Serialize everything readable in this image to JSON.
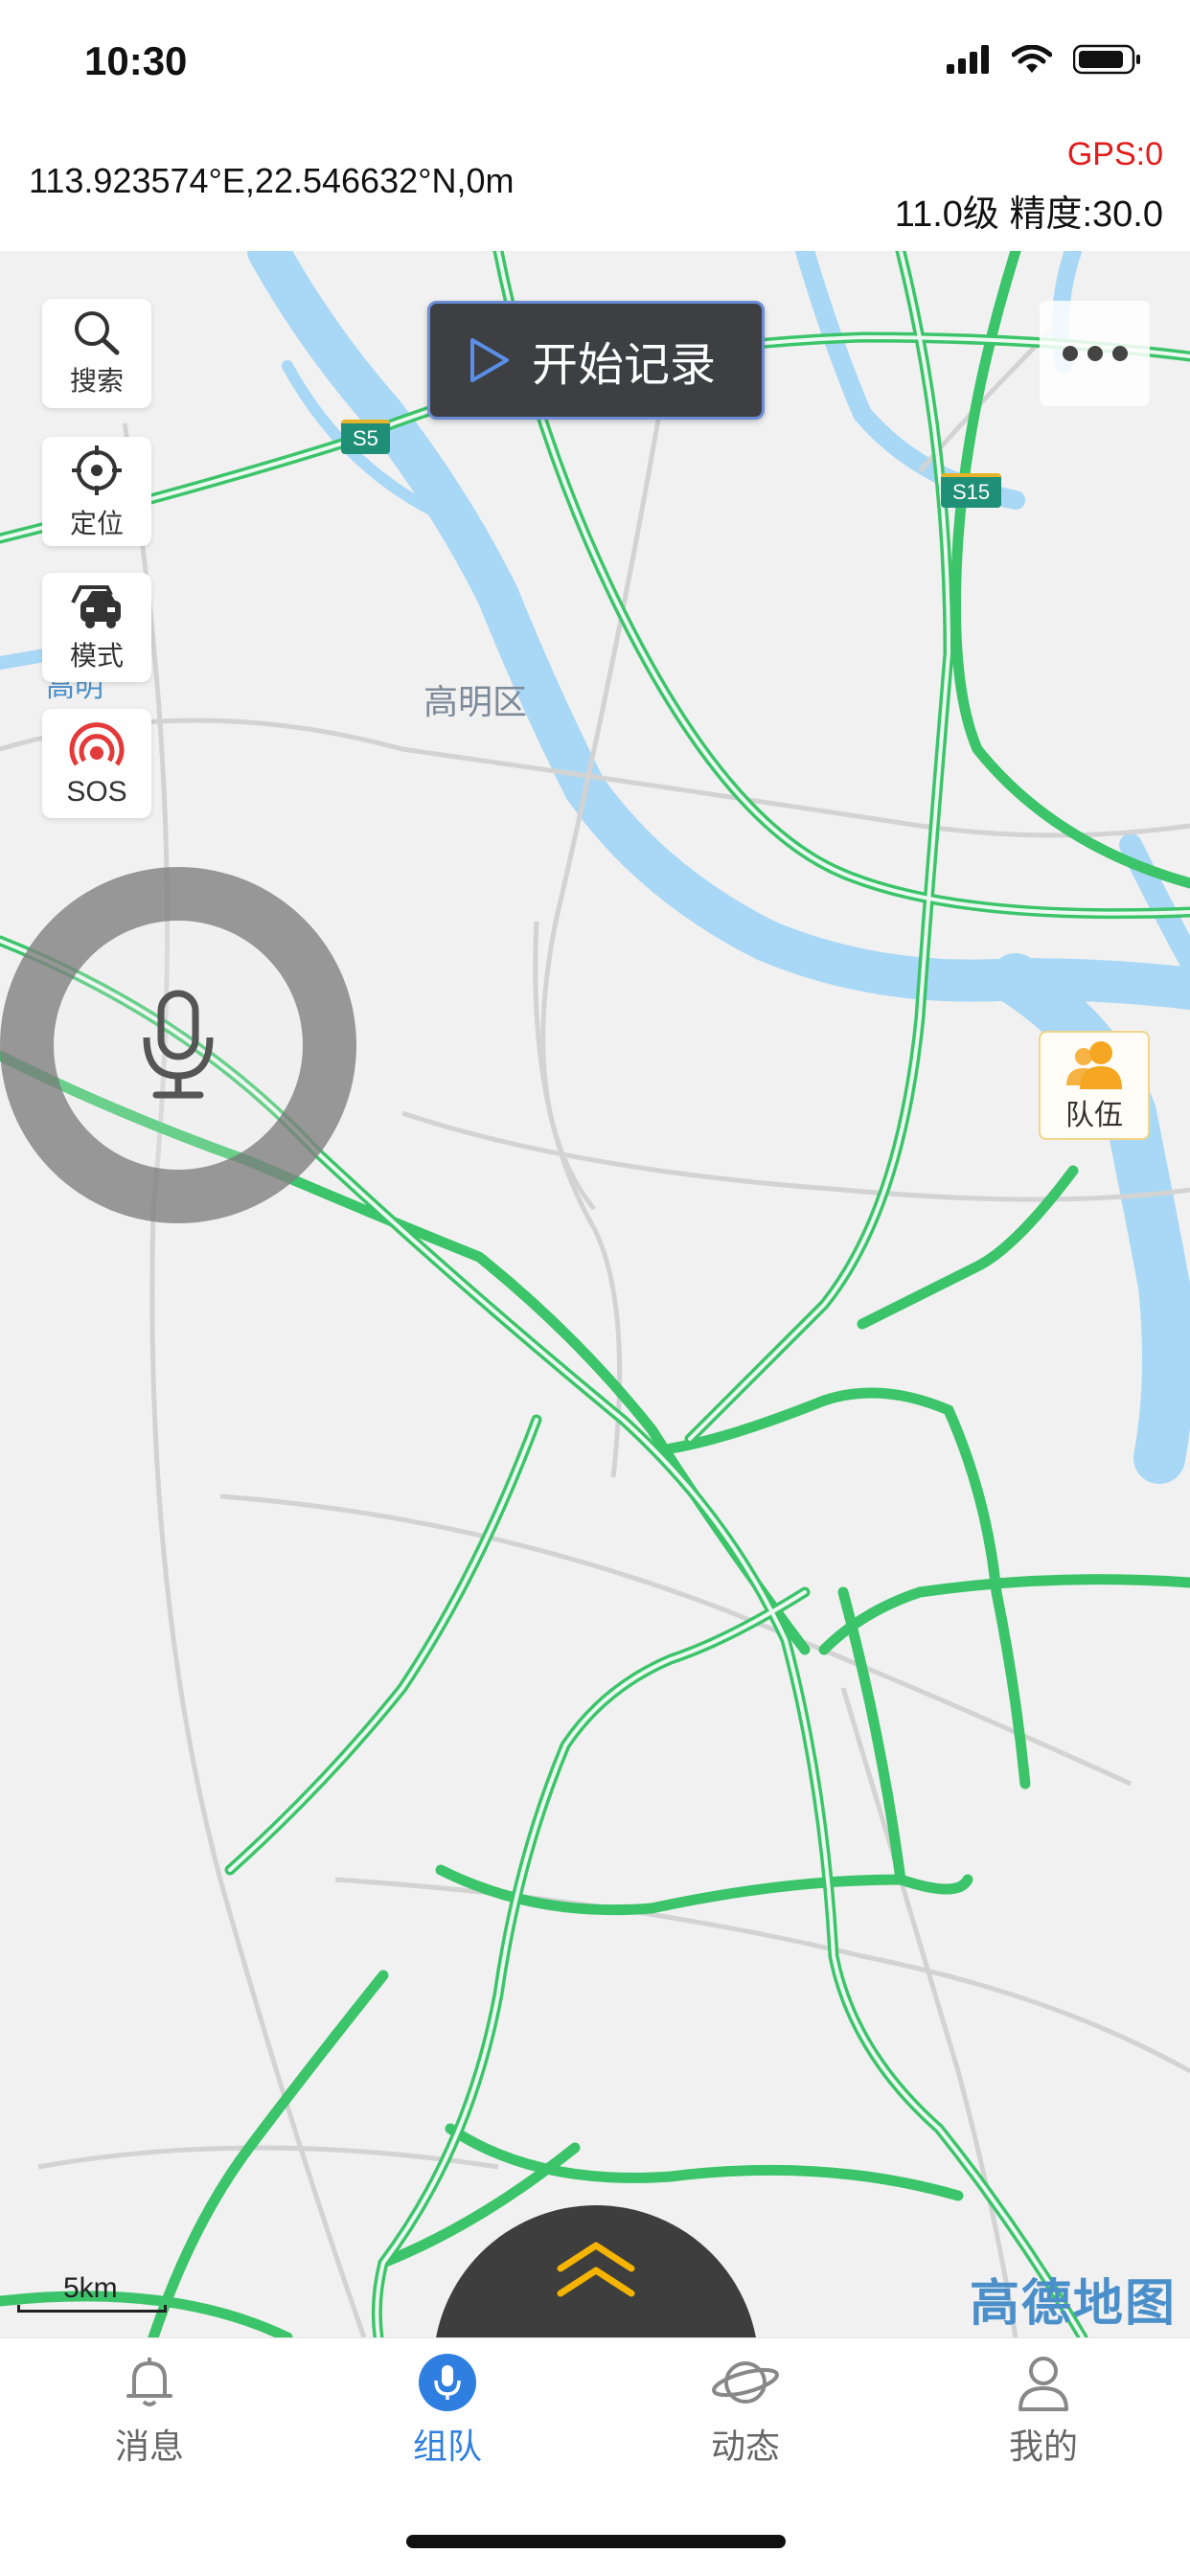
{
  "status": {
    "time": "10:30"
  },
  "info": {
    "coords": "113.923574°E,22.546632°N,0m",
    "gps": "GPS:0",
    "zoom_precision": "11.0级 精度:30.0"
  },
  "side_buttons": [
    {
      "label": "搜索",
      "icon": "search-icon"
    },
    {
      "label": "定位",
      "icon": "locate-icon"
    },
    {
      "label": "模式",
      "icon": "car-mode-icon"
    },
    {
      "label": "SOS",
      "icon": "sos-icon"
    }
  ],
  "record_button": {
    "label": "开始记录",
    "icon": "play-icon"
  },
  "team_button": {
    "label": "队伍",
    "icon": "team-icon"
  },
  "map": {
    "district": "高明区",
    "partial_label": "高明",
    "highway_shields": [
      "S5",
      "S15"
    ],
    "scale": "5km",
    "logo": "高德地图"
  },
  "tabs": [
    {
      "label": "消息",
      "icon": "bell-icon",
      "active": false
    },
    {
      "label": "组队",
      "icon": "mic-tab-icon",
      "active": true
    },
    {
      "label": "动态",
      "icon": "planet-icon",
      "active": false
    },
    {
      "label": "我的",
      "icon": "profile-icon",
      "active": false
    }
  ],
  "colors": {
    "accent": "#2f7fe0",
    "gps_warning": "#e21b1b",
    "road_green": "#3cc46a",
    "water": "#a8d8f5",
    "team_icon": "#f5a623"
  }
}
